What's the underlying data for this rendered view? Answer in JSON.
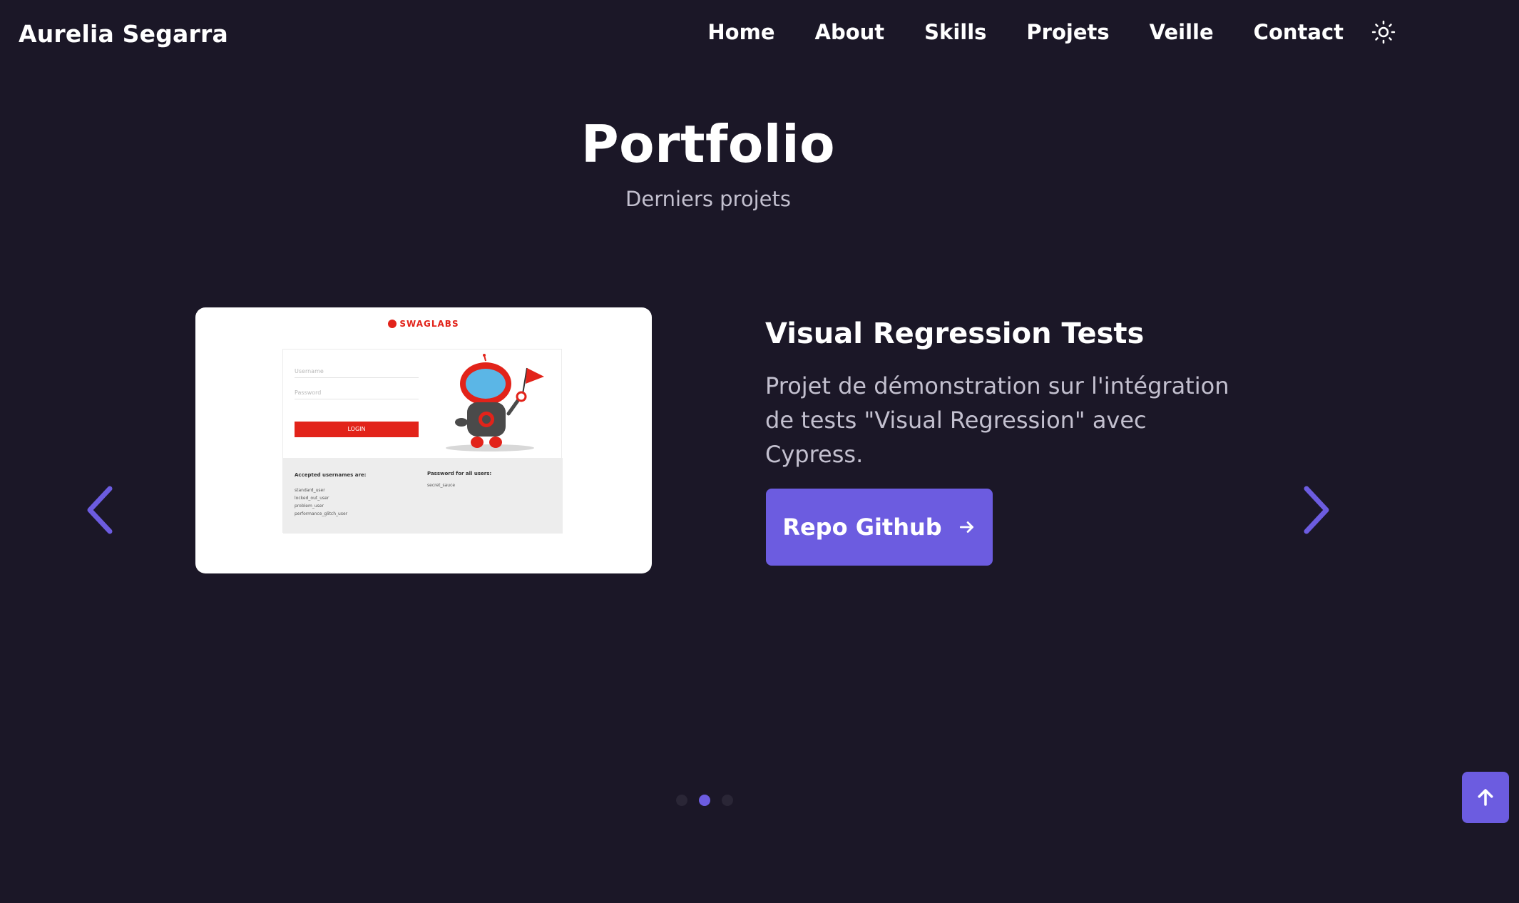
{
  "header": {
    "brand": "Aurelia Segarra",
    "nav": [
      "Home",
      "About",
      "Skills",
      "Projets",
      "Veille",
      "Contact"
    ],
    "theme_icon": "sun-icon"
  },
  "section": {
    "title": "Portfolio",
    "subtitle": "Derniers projets"
  },
  "project": {
    "title": "Visual Regression Tests",
    "description": "Projet de démonstration sur l'intégration de tests \"Visual Regression\" avec Cypress.",
    "button_label": "Repo Github",
    "button_icon": "arrow-right-icon",
    "screenshot": {
      "logo": "SWAGLABS",
      "username_placeholder": "Username",
      "password_placeholder": "Password",
      "login_label": "LOGIN",
      "usernames_heading": "Accepted usernames are:",
      "usernames": "standard_user\nlocked_out_user\nproblem_user\nperformance_glitch_user",
      "password_heading": "Password for all users:",
      "password": "secret_sauce"
    }
  },
  "carousel": {
    "prev_icon": "chevron-left-icon",
    "next_icon": "chevron-right-icon",
    "slide_count": 3,
    "active_slide": 2
  },
  "scroll_top_icon": "arrow-up-icon",
  "colors": {
    "background": "#1b1727",
    "accent": "#6c5ce0",
    "muted_text": "#c3c0cf"
  }
}
